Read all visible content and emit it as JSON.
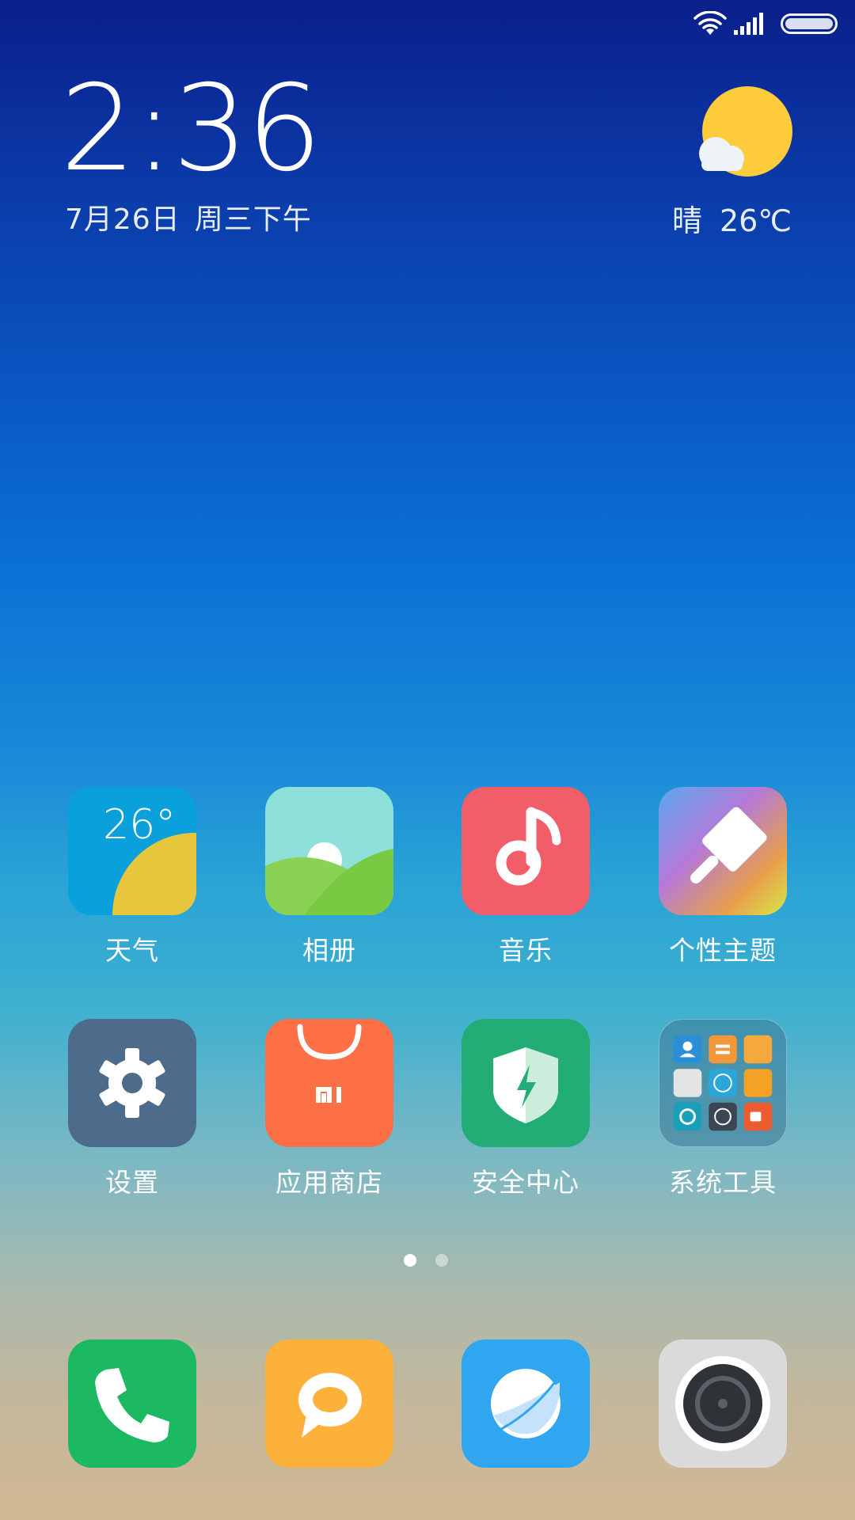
{
  "status_bar": {
    "wifi_icon": "wifi-icon",
    "signal_icon": "signal-icon",
    "battery_icon": "battery-icon"
  },
  "clock_widget": {
    "time": "2:36",
    "date": "7月26日",
    "weekday_period": "周三下午"
  },
  "weather_widget": {
    "icon": "sunny-cloud-icon",
    "condition": "晴",
    "temperature": "26℃"
  },
  "apps": [
    {
      "label": "天气",
      "icon": "weather-icon",
      "tile_text": "26°"
    },
    {
      "label": "相册",
      "icon": "gallery-icon"
    },
    {
      "label": "音乐",
      "icon": "music-icon"
    },
    {
      "label": "个性主题",
      "icon": "themes-icon"
    },
    {
      "label": "设置",
      "icon": "settings-icon"
    },
    {
      "label": "应用商店",
      "icon": "app-store-icon"
    },
    {
      "label": "安全中心",
      "icon": "security-icon"
    },
    {
      "label": "系统工具",
      "icon": "system-tools-folder-icon"
    }
  ],
  "page_indicator": {
    "pages": 2,
    "current": 1
  },
  "dock": [
    {
      "icon": "phone-icon"
    },
    {
      "icon": "messages-icon"
    },
    {
      "icon": "browser-icon"
    },
    {
      "icon": "camera-icon"
    }
  ],
  "colors": {
    "weather_tile": "#0aa0dc",
    "gallery_tile": "#8fe0da",
    "music_tile": "#f25d6a",
    "settings_tile": "#4d6b8a",
    "store_tile": "#fd6f45",
    "security_tile": "#23ad76",
    "phone_tile": "#1cb862",
    "messages_tile": "#fcb13b",
    "browser_tile": "#2fa6ef",
    "camera_tile": "#dadada"
  }
}
